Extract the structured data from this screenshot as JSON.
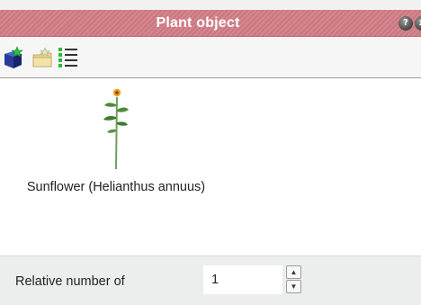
{
  "window": {
    "title": "Plant object",
    "help_glyph": "?",
    "close_glyph": "x"
  },
  "toolbar": {
    "icons": [
      "add-object-icon",
      "folder-star-icon",
      "list-view-icon"
    ]
  },
  "plants": [
    {
      "name": "Sunflower (Helianthus annuus)",
      "icon": "sunflower-icon"
    }
  ],
  "bottom": {
    "relative_label": "Relative number of",
    "relative_value": "1"
  }
}
